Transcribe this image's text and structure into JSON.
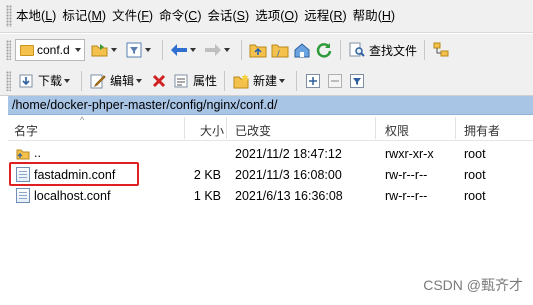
{
  "menu": {
    "items": [
      {
        "label": "本地",
        "mn": "L"
      },
      {
        "label": "标记",
        "mn": "M"
      },
      {
        "label": "文件",
        "mn": "F"
      },
      {
        "label": "命令",
        "mn": "C"
      },
      {
        "label": "会话",
        "mn": "S"
      },
      {
        "label": "选项",
        "mn": "O"
      },
      {
        "label": "远程",
        "mn": "R"
      },
      {
        "label": "帮助",
        "mn": "H"
      }
    ]
  },
  "toolbar": {
    "folder_combo_value": "conf.d",
    "find_files_label": "查找文件",
    "download_label": "下载",
    "edit_label": "编辑",
    "properties_label": "属性",
    "new_label": "新建"
  },
  "path": "/home/docker-phper-master/config/nginx/conf.d/",
  "columns": {
    "name": "名字",
    "size": "大小",
    "modified": "已改变",
    "permissions": "权限",
    "owner": "拥有者"
  },
  "files": [
    {
      "name": "..",
      "size": "",
      "modified": "2021/11/2 18:47:12",
      "permissions": "rwxr-xr-x",
      "owner": "root",
      "icon": "parent-dir-icon"
    },
    {
      "name": "fastadmin.conf",
      "size": "2 KB",
      "modified": "2021/11/3 16:08:00",
      "permissions": "rw-r--r--",
      "owner": "root",
      "icon": "file-icon"
    },
    {
      "name": "localhost.conf",
      "size": "1 KB",
      "modified": "2021/6/13 16:36:08",
      "permissions": "rw-r--r--",
      "owner": "root",
      "icon": "file-icon"
    }
  ],
  "watermark": "CSDN @甄齐才",
  "colors": {
    "path_bar": "#a9c5e6",
    "highlight_box": "#e02020"
  }
}
